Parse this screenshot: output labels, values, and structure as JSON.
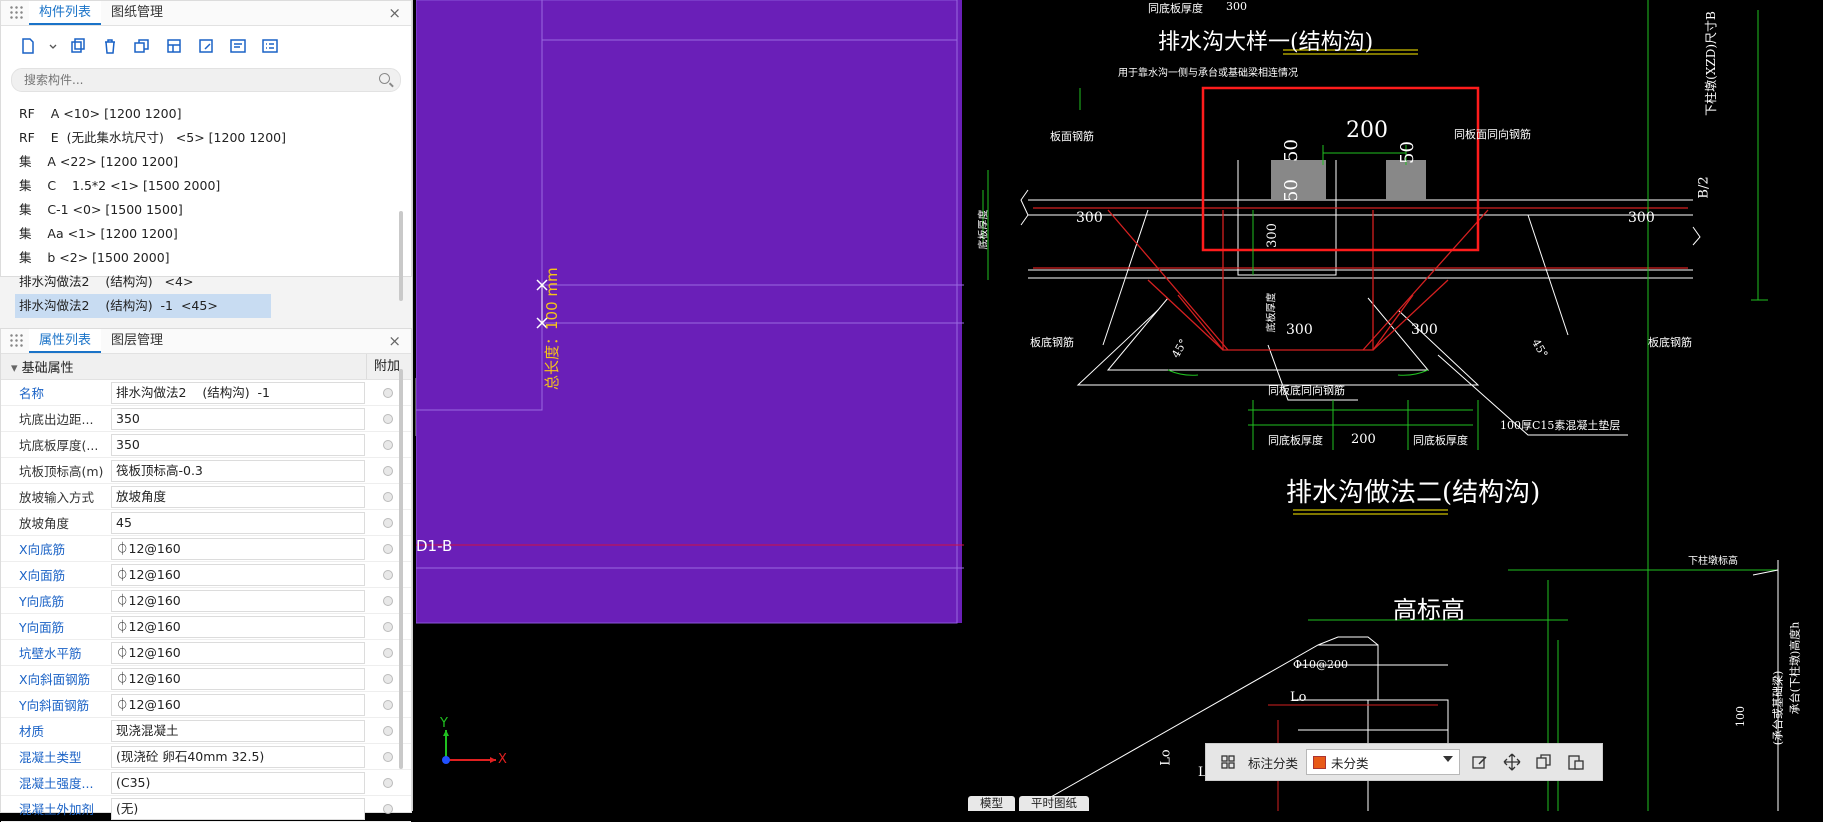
{
  "component_panel": {
    "tabs": [
      "构件列表",
      "图纸管理"
    ],
    "search_placeholder": "搜索构件...",
    "items": [
      "RF    A <10> [1200 1200]",
      "RF    E  (无此集水坑尺寸)   <5> [1200 1200]",
      "集    A <22> [1200 1200]",
      "集    C    1.5*2 <1> [1500 2000]",
      "集    C-1 <0> [1500 1500]",
      "集    Aa <1> [1200 1200]",
      "集    b <2> [1500 2000]",
      "排水沟做法2    (结构沟)   <4>",
      "排水沟做法2    (结构沟)  -1  <45>"
    ]
  },
  "property_panel": {
    "tabs": [
      "属性列表",
      "图层管理"
    ],
    "section": "基础属性",
    "extra_header": "附加",
    "rows": [
      {
        "name": "名称",
        "value": "排水沟做法2    (结构沟)  -1",
        "blue": true
      },
      {
        "name": "坑底出边距...",
        "value": "350",
        "blue": false
      },
      {
        "name": "坑底板厚度(...",
        "value": "350",
        "blue": false
      },
      {
        "name": "坑板顶标高(m)",
        "value": "筏板顶标高-0.3",
        "blue": false
      },
      {
        "name": "放坡输入方式",
        "value": "放坡角度",
        "blue": false
      },
      {
        "name": "放坡角度",
        "value": "45",
        "blue": false
      },
      {
        "name": "X向底筋",
        "value": "⏀12@160",
        "blue": true
      },
      {
        "name": "X向面筋",
        "value": "⏀12@160",
        "blue": true
      },
      {
        "name": "Y向底筋",
        "value": "⏀12@160",
        "blue": true
      },
      {
        "name": "Y向面筋",
        "value": "⏀12@160",
        "blue": true
      },
      {
        "name": "坑壁水平筋",
        "value": "⏀12@160",
        "blue": true
      },
      {
        "name": "X向斜面钢筋",
        "value": "⏀12@160",
        "blue": true
      },
      {
        "name": "Y向斜面钢筋",
        "value": "⏀12@160",
        "blue": true
      },
      {
        "name": "材质",
        "value": "现浇混凝土",
        "blue": true
      },
      {
        "name": "混凝土类型",
        "value": "(现浇砼 卵石40mm 32.5)",
        "blue": true
      },
      {
        "name": "混凝土强度...",
        "value": "(C35)",
        "blue": true
      },
      {
        "name": "混凝土外加剂",
        "value": "(无)",
        "blue": true
      }
    ]
  },
  "viewport": {
    "dimension_label": "总长度：100 mm",
    "axis_label": "D1-B",
    "axis_x": "X",
    "axis_y": "Y"
  },
  "cad": {
    "title1": "排水沟大样一(结构沟)",
    "note1": "用于靠水沟一侧与承台或基础梁相连情况",
    "title2": "排水沟做法二(结构沟)",
    "title3": "高标高",
    "dim_200": "200",
    "dim_50a": "50",
    "dim_50b": "50",
    "dim_50c": "50",
    "dim_300_l": "300",
    "dim_300_r": "300",
    "dim_300_v": "300",
    "dim_300_b1": "300",
    "dim_300_b2": "300",
    "label_banmian": "板面钢筋",
    "label_tongbanmian": "同板面同向钢筋",
    "label_bandi_l": "板底钢筋",
    "label_bandi_r": "板底钢筋",
    "label_tongbandi": "同板底同向钢筋",
    "label_dianceng": "100厚C15素混凝土垫层",
    "label_houdu_l": "同底板厚度",
    "label_houdu_r": "同底板厚度",
    "label_200b": "200",
    "angle_l": "45°",
    "angle_r": "45°",
    "label_dbhd": "底板厚度",
    "label_dbhd2": "底板厚度",
    "label_phi10": "Φ10@200",
    "label_lo1": "Lo",
    "label_lo2": "Lo",
    "label_lo3": "Lo",
    "label_b2": "B/2",
    "label_top1": "同底板厚度",
    "label_top2": "300",
    "label_right_v": "下柱墩(XZD)尺寸B",
    "label_right_v2": "下柱墩标高",
    "label_right_v3": "承台(下柱墩)高度h",
    "label_right_v4": "100",
    "label_right_v5": "(承台或基础梁)"
  },
  "bottom_bar": {
    "label": "标注分类",
    "selected": "未分类"
  },
  "sheet_tabs": [
    "模型",
    "平时图纸"
  ]
}
